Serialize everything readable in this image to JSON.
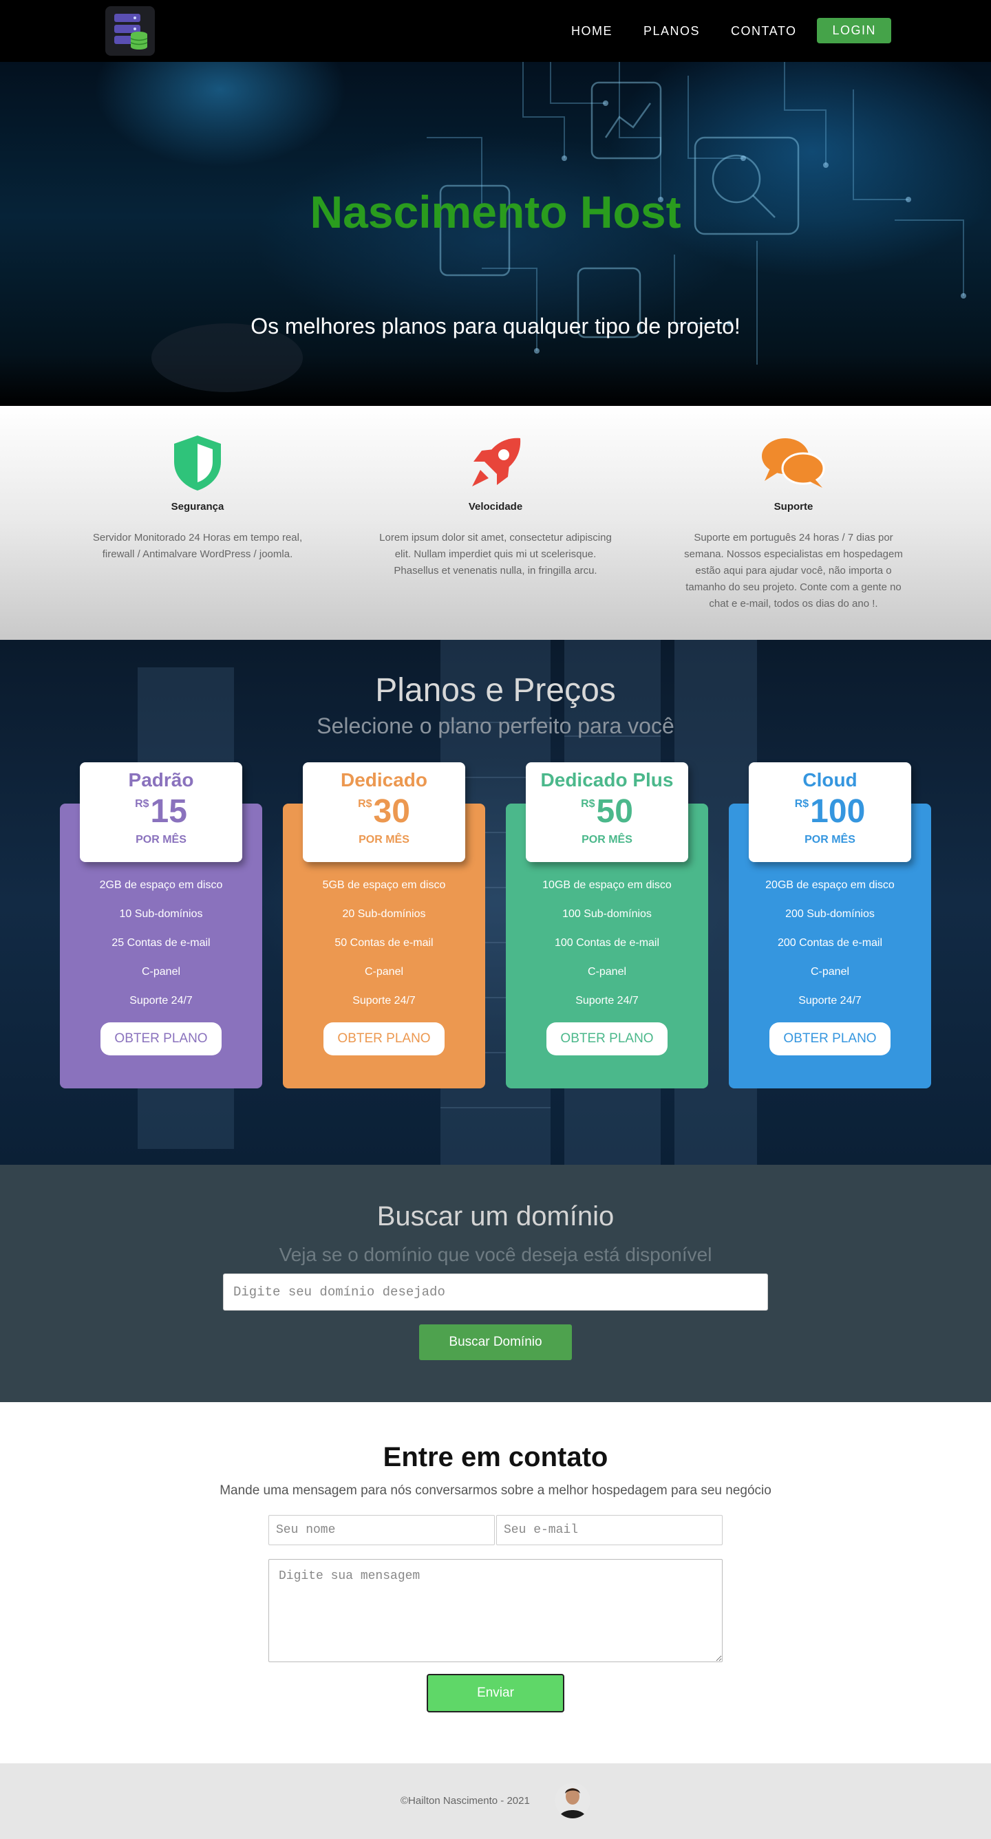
{
  "nav": {
    "logo_icon": "server-database-icon",
    "links": [
      "HOME",
      "PLANOS",
      "CONTATO"
    ],
    "login_label": "LOGIN"
  },
  "hero": {
    "title": "Nascimento Host",
    "subtitle": "Os melhores planos para qualquer tipo de projeto!"
  },
  "features": [
    {
      "icon": "shield-icon",
      "title": "Segurança",
      "text": "Servidor Monitorado 24 Horas em tempo real, firewall / Antimalvare WordPress / joomla."
    },
    {
      "icon": "rocket-icon",
      "title": "Velocidade",
      "text": "Lorem ipsum dolor sit amet, consectetur adipiscing elit. Nullam imperdiet quis mi ut scelerisque. Phasellus et venenatis nulla, in fringilla arcu."
    },
    {
      "icon": "chat-bubbles-icon",
      "title": "Suporte",
      "text": "Suporte em português 24 horas / 7 dias por semana. Nossos especialistas em hospedagem estão aqui para ajudar você, não importa o tamanho do seu projeto. Conte com a gente no chat e e-mail, todos os dias do ano !."
    }
  ],
  "plans": {
    "title": "Planos e Preços",
    "subtitle": "Selecione o plano perfeito para você",
    "items": [
      {
        "name": "Padrão",
        "currency": "R$",
        "price": "15",
        "period": "POR MÊS",
        "color": "#8a72bd",
        "features": [
          "2GB de espaço em disco",
          "10 Sub-domínios",
          "25 Contas de e-mail",
          "C-panel",
          "Suporte 24/7"
        ],
        "button": "OBTER PLANO"
      },
      {
        "name": "Dedicado",
        "currency": "R$",
        "price": "30",
        "period": "POR MÊS",
        "color": "#ec9850",
        "features": [
          "5GB de espaço em disco",
          "20 Sub-domínios",
          "50 Contas de e-mail",
          "C-panel",
          "Suporte 24/7"
        ],
        "button": "OBTER PLANO"
      },
      {
        "name": "Dedicado Plus",
        "currency": "R$",
        "price": "50",
        "period": "POR MÊS",
        "color": "#4bb88b",
        "features": [
          "10GB de espaço em disco",
          "100 Sub-domínios",
          "100 Contas de e-mail",
          "C-panel",
          "Suporte 24/7"
        ],
        "button": "OBTER PLANO"
      },
      {
        "name": "Cloud",
        "currency": "R$",
        "price": "100",
        "period": "POR MÊS",
        "color": "#3596df",
        "features": [
          "20GB de espaço em disco",
          "200 Sub-domínios",
          "200 Contas de e-mail",
          "C-panel",
          "Suporte 24/7"
        ],
        "button": "OBTER PLANO"
      }
    ]
  },
  "domain": {
    "title": "Buscar um domínio",
    "subtitle": "Veja se o domínio que você deseja está disponível",
    "placeholder": "Digite seu domínio desejado",
    "button": "Buscar Domínio"
  },
  "contact": {
    "title": "Entre em contato",
    "subtitle": "Mande uma mensagem para nós conversarmos sobre a melhor hospedagem para seu negócio",
    "name_placeholder": "Seu nome",
    "email_placeholder": "Seu e-mail",
    "message_placeholder": "Digite sua mensagem",
    "button": "Enviar"
  },
  "footer": {
    "copyright": "©Hailton Nascimento - 2021"
  },
  "colors": {
    "hero_title": "#2a9c1e",
    "login_button": "#45a349",
    "domain_bg": "#34444d",
    "send_button": "#5fd768"
  }
}
